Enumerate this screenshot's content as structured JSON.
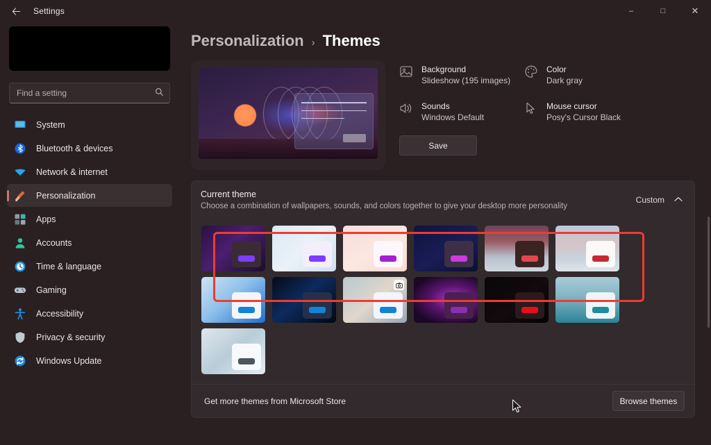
{
  "window": {
    "title": "Settings",
    "back_icon": "arrow-left-icon",
    "minimize_label": "–",
    "maximize_label": "□",
    "close_label": "✕"
  },
  "sidebar": {
    "search": {
      "placeholder": "Find a setting",
      "value": "",
      "icon": "search-icon"
    },
    "items": [
      {
        "label": "System",
        "icon": "display-icon",
        "selected": false
      },
      {
        "label": "Bluetooth & devices",
        "icon": "bluetooth-icon",
        "selected": false
      },
      {
        "label": "Network & internet",
        "icon": "wifi-icon",
        "selected": false
      },
      {
        "label": "Personalization",
        "icon": "paintbrush-icon",
        "selected": true
      },
      {
        "label": "Apps",
        "icon": "apps-icon",
        "selected": false
      },
      {
        "label": "Accounts",
        "icon": "person-icon",
        "selected": false
      },
      {
        "label": "Time & language",
        "icon": "clock-icon",
        "selected": false
      },
      {
        "label": "Gaming",
        "icon": "gamepad-icon",
        "selected": false
      },
      {
        "label": "Accessibility",
        "icon": "accessibility-icon",
        "selected": false
      },
      {
        "label": "Privacy & security",
        "icon": "shield-icon",
        "selected": false
      },
      {
        "label": "Windows Update",
        "icon": "update-icon",
        "selected": false
      }
    ]
  },
  "breadcrumb": {
    "parent": "Personalization",
    "separator": "›",
    "current": "Themes"
  },
  "properties": [
    {
      "name": "Background",
      "value": "Slideshow (195 images)",
      "icon": "image-icon"
    },
    {
      "name": "Color",
      "value": "Dark gray",
      "icon": "palette-icon"
    },
    {
      "name": "Sounds",
      "value": "Windows Default",
      "icon": "speaker-icon"
    },
    {
      "name": "Mouse cursor",
      "value": "Posy's Cursor Black",
      "icon": "cursor-icon"
    }
  ],
  "save_button": {
    "label": "Save"
  },
  "current_theme": {
    "title": "Current theme",
    "subtitle": "Choose a combination of wallpapers, sounds, and colors together to give your desktop more personality",
    "value": "Custom",
    "chevron": "∧"
  },
  "themes": [
    {
      "name": "flow-dark",
      "accent": "#7b4dff",
      "win_bg": "#3a2b36",
      "pill": "#7b3dff",
      "bg": "linear-gradient(135deg,#2a1140 0%,#4a1f6e 45%,#1d0d2e 100%)"
    },
    {
      "name": "flow-light",
      "accent": "#7b4dff",
      "win_bg": "#f3eefb",
      "pill": "#7b3dff",
      "bg": "linear-gradient(135deg,#dbeaf6 0%,#eaf1f8 50%,#cfe0f0 100%)"
    },
    {
      "name": "cosmos-light",
      "accent": "#a41fd0",
      "win_bg": "#fdf7fb",
      "pill": "#a41fd0",
      "bg": "linear-gradient(150deg,#f8dede 0%,#fbe7e0 55%,#fcd9cf 100%)"
    },
    {
      "name": "cosmos-dark",
      "accent": "#cc3ae0",
      "win_bg": "#3c2f46",
      "pill": "#cc3ae0",
      "bg": "linear-gradient(150deg,#0e1440 0%,#1a1c55 55%,#0b0f33 100%)"
    },
    {
      "name": "glow-dark",
      "accent": "#e0484f",
      "win_bg": "#3a2422",
      "pill": "#e0484f",
      "bg": "linear-gradient(180deg,#6d4458 0%,#9a5b63 35%,#b8c3cf 70%,#cfd6dd 100%)"
    },
    {
      "name": "glow-light",
      "accent": "#c32b34",
      "win_bg": "#fbf8f8",
      "pill": "#c32b34",
      "bg": "linear-gradient(180deg,#b9c9dc 0%,#d6c3c6 40%,#c9d3dd 72%,#dfe5ea 100%)"
    },
    {
      "name": "windows-light",
      "accent": "#1383d6",
      "win_bg": "#f2f6fb",
      "pill": "#1383d6",
      "bg": "linear-gradient(140deg,#cfe3f5 0%,#8fc0ea 45%,#1f6fd0 100%)"
    },
    {
      "name": "windows-dark",
      "accent": "#1383d6",
      "win_bg": "#24304a",
      "pill": "#1383d6",
      "bg": "linear-gradient(140deg,#050a18 0%,#0d2a5e 45%,#030610 100%)"
    },
    {
      "name": "windows-spotlight",
      "accent": "#1383d6",
      "win_bg": "#f2f6fb",
      "pill": "#1383d6",
      "bg": "linear-gradient(140deg,#b8c9cf 0%,#e0d6cc 50%,#9aa6b4 100%)",
      "badge": "📷"
    },
    {
      "name": "purple-glow",
      "accent": "#8a2fb0",
      "win_bg": "#4a2050",
      "pill": "#8a2fb0",
      "bg": "radial-gradient(ellipse at 62% 48%, #a83ac9 0%, #5c1570 38%, #1b0726 78%)"
    },
    {
      "name": "dark-floral",
      "accent": "#e01020",
      "win_bg": "#2b1a1c",
      "pill": "#e01020",
      "bg": "linear-gradient(140deg,#0a0608 0%,#120a0d 55%,#050305 100%)"
    },
    {
      "name": "teal-landscape",
      "accent": "#1f8c9e",
      "win_bg": "#eef5f7",
      "pill": "#1f8c9e",
      "bg": "linear-gradient(180deg,#a9cbd8 0%,#7fb3c2 45%,#2b8396 100%)"
    },
    {
      "name": "windows-swirl-light",
      "accent": "#4a5560",
      "win_bg": "#f7fafc",
      "pill": "#4a5560",
      "bg": "linear-gradient(140deg,#dde6ec 0%,#b9ccd8 50%,#e6edf2 100%)"
    }
  ],
  "store": {
    "text": "Get more themes from Microsoft Store",
    "button": "Browse themes"
  },
  "annotation": {
    "color": "#f03b30"
  },
  "cursor": {
    "icon": "mouse-pointer-icon"
  },
  "colors": {
    "accent": "#c47a64",
    "page_bg": "#2a2022",
    "card_bg": "#322a2c"
  }
}
